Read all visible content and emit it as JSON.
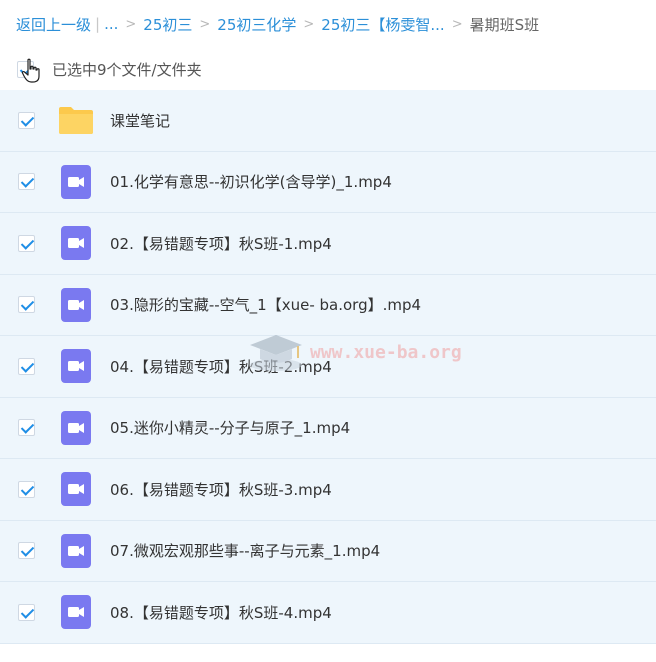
{
  "breadcrumb": {
    "back": "返回上一级",
    "ellipsis": "...",
    "items": [
      "25初三",
      "25初三化学",
      "25初三【杨雯智..."
    ],
    "current": "暑期班S班"
  },
  "selection": {
    "text": "已选中9个文件/文件夹",
    "all_checked": true
  },
  "files": [
    {
      "name": "课堂笔记",
      "type": "folder"
    },
    {
      "name": "01.化学有意思--初识化学(含导学)_1.mp4",
      "type": "video"
    },
    {
      "name": "02.【易错题专项】秋S班-1.mp4",
      "type": "video"
    },
    {
      "name": "03.隐形的宝藏--空气_1【xue- ba.org】.mp4",
      "type": "video"
    },
    {
      "name": "04.【易错题专项】秋S班-2.mp4",
      "type": "video"
    },
    {
      "name": "05.迷你小精灵--分子与原子_1.mp4",
      "type": "video"
    },
    {
      "name": "06.【易错题专项】秋S班-3.mp4",
      "type": "video"
    },
    {
      "name": "07.微观宏观那些事--离子与元素_1.mp4",
      "type": "video"
    },
    {
      "name": "08.【易错题专项】秋S班-4.mp4",
      "type": "video"
    }
  ],
  "watermark": {
    "text": "www.xue-ba.org"
  },
  "colors": {
    "link": "#2b8fd8",
    "video_icon": "#7a79f0",
    "folder": "#fcc94c",
    "checkbox": "#1f8ee6",
    "row_bg": "#eef6fc"
  }
}
